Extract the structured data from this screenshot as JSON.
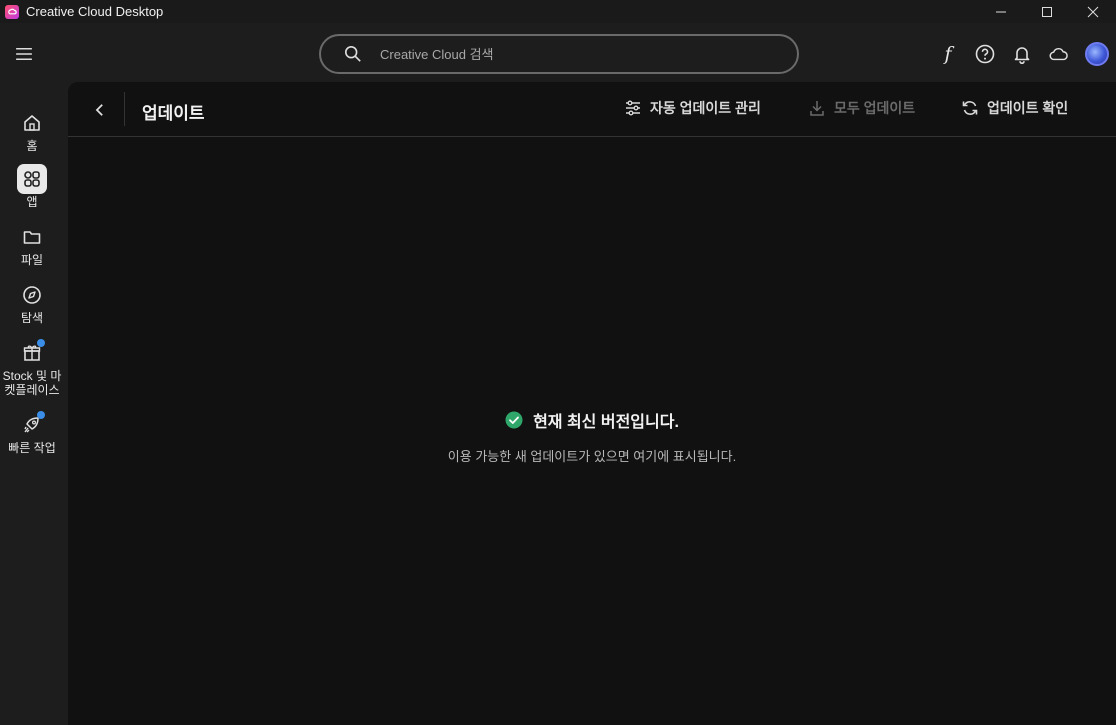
{
  "window": {
    "title": "Creative Cloud Desktop"
  },
  "search": {
    "placeholder": "Creative Cloud 검색"
  },
  "header_icons": [
    "fonts-icon",
    "help-icon",
    "bell-icon",
    "cloud-icon",
    "avatar"
  ],
  "nav": {
    "items": [
      {
        "label": "홈",
        "icon": "home-icon"
      },
      {
        "label": "앱",
        "icon": "apps-icon",
        "active": true
      },
      {
        "label": "파일",
        "icon": "folder-icon"
      },
      {
        "label": "탐색",
        "icon": "compass-icon"
      },
      {
        "label": "Stock 및 마켓플레이스",
        "icon": "store-icon",
        "badge": true
      },
      {
        "label": "빠른 작업",
        "icon": "rocket-icon",
        "badge": true
      }
    ]
  },
  "page": {
    "title": "업데이트",
    "actions": {
      "auto_update": "자동 업데이트 관리",
      "update_all": "모두 업데이트",
      "check_updates": "업데이트 확인"
    },
    "status": {
      "title": "현재 최신 버전입니다.",
      "subtitle": "이용 가능한 새 업데이트가 있으면 여기에 표시됩니다."
    }
  },
  "colors": {
    "accent_blue": "#3b8ee8",
    "success_green": "#2fa66a",
    "panel_bg": "#111111",
    "app_bg": "#1d1d1d"
  }
}
